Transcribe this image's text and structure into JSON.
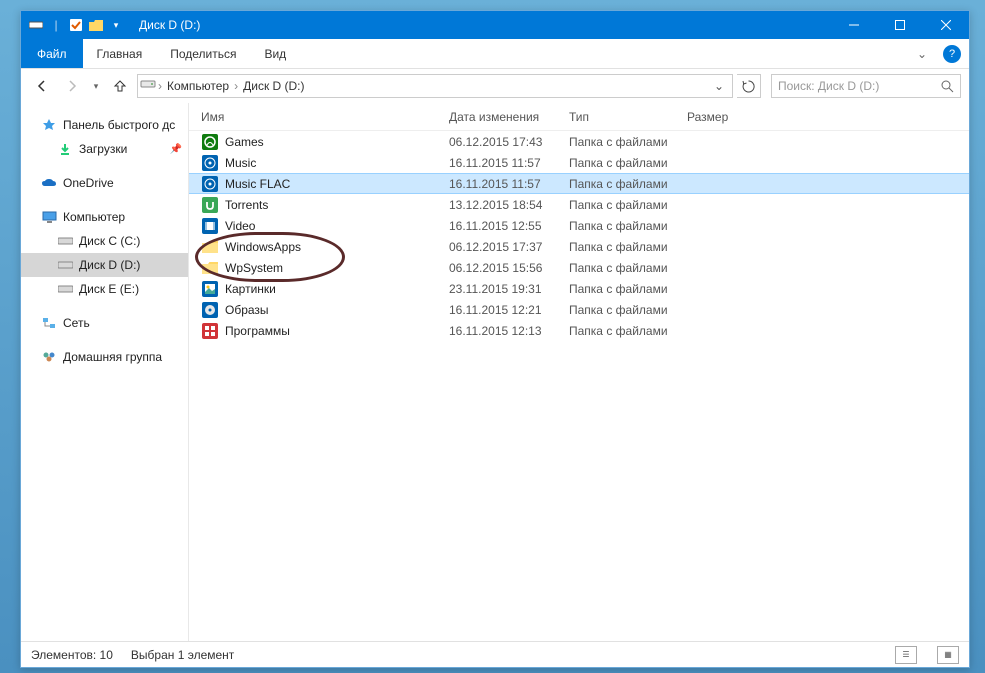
{
  "title": "Диск D (D:)",
  "ribbon": {
    "file": "Файл",
    "tabs": [
      "Главная",
      "Поделиться",
      "Вид"
    ]
  },
  "breadcrumb": [
    "Компьютер",
    "Диск D (D:)"
  ],
  "search_placeholder": "Поиск: Диск D (D:)",
  "columns": {
    "name": "Имя",
    "modified": "Дата изменения",
    "type": "Тип",
    "size": "Размер"
  },
  "nav": {
    "quick": "Панель быстрого дс",
    "downloads": "Загрузки",
    "onedrive": "OneDrive",
    "computer": "Компьютер",
    "drives": [
      "Диск C (C:)",
      "Диск D (D:)",
      "Диск E (E:)"
    ],
    "network": "Сеть",
    "homegroup": "Домашняя группа"
  },
  "rows": [
    {
      "icon": "xbox",
      "name": "Games",
      "modified": "06.12.2015 17:43",
      "type": "Папка с файлами",
      "selected": false
    },
    {
      "icon": "media",
      "name": "Music",
      "modified": "16.11.2015 11:57",
      "type": "Папка с файлами",
      "selected": false
    },
    {
      "icon": "media",
      "name": "Music FLAC",
      "modified": "16.11.2015 11:57",
      "type": "Папка с файлами",
      "selected": true
    },
    {
      "icon": "utorrent",
      "name": "Torrents",
      "modified": "13.12.2015 18:54",
      "type": "Папка с файлами",
      "selected": false
    },
    {
      "icon": "video",
      "name": "Video",
      "modified": "16.11.2015 12:55",
      "type": "Папка с файлами",
      "selected": false
    },
    {
      "icon": "folder",
      "name": "WindowsApps",
      "modified": "06.12.2015 17:37",
      "type": "Папка с файлами",
      "selected": false
    },
    {
      "icon": "folder",
      "name": "WpSystem",
      "modified": "06.12.2015 15:56",
      "type": "Папка с файлами",
      "selected": false
    },
    {
      "icon": "pictures",
      "name": "Картинки",
      "modified": "23.11.2015 19:31",
      "type": "Папка с файлами",
      "selected": false
    },
    {
      "icon": "iso",
      "name": "Образы",
      "modified": "16.11.2015 12:21",
      "type": "Папка с файлами",
      "selected": false
    },
    {
      "icon": "apps",
      "name": "Программы",
      "modified": "16.11.2015 12:13",
      "type": "Папка с файлами",
      "selected": false
    }
  ],
  "status": {
    "count": "Элементов: 10",
    "selection": "Выбран 1 элемент"
  }
}
